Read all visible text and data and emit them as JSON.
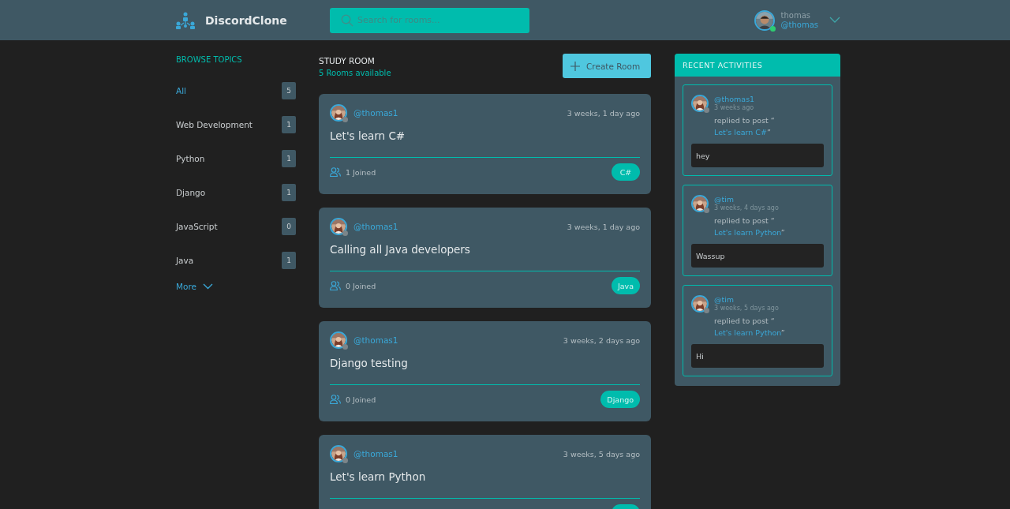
{
  "header": {
    "logo": "DiscordClone",
    "search": {
      "placeholder": "Search for rooms..."
    },
    "user": {
      "name": "thomas",
      "handle": "@thomas",
      "online": true
    }
  },
  "sidebar": {
    "title": "BROWSE TOPICS",
    "items": [
      {
        "label": "All",
        "count": "5",
        "selected": true
      },
      {
        "label": "Web Development",
        "count": "1",
        "selected": false
      },
      {
        "label": "Python",
        "count": "1",
        "selected": false
      },
      {
        "label": "Django",
        "count": "1",
        "selected": false
      },
      {
        "label": "JavaScript",
        "count": "0",
        "selected": false
      },
      {
        "label": "Java",
        "count": "1",
        "selected": false
      }
    ],
    "more": "More"
  },
  "main": {
    "title": "STUDY ROOM",
    "subtitle": "5 Rooms available",
    "create_button": "Create Room",
    "rooms": [
      {
        "host": "@thomas1",
        "online": false,
        "time": "3 weeks, 1 day ago",
        "name": "Let's learn C#",
        "joined": "1 Joined",
        "topic": "C#"
      },
      {
        "host": "@thomas1",
        "online": false,
        "time": "3 weeks, 1 day ago",
        "name": "Calling all Java developers",
        "joined": "0 Joined",
        "topic": "Java"
      },
      {
        "host": "@thomas1",
        "online": false,
        "time": "3 weeks, 2 days ago",
        "name": "Django testing",
        "joined": "0 Joined",
        "topic": "Django"
      },
      {
        "host": "@thomas1",
        "online": false,
        "time": "3 weeks, 5 days ago",
        "name": "Let's learn Python"
      }
    ]
  },
  "activities": {
    "title": "RECENT ACTIVITIES",
    "items": [
      {
        "user": "@thomas1",
        "online": false,
        "time": "3 weeks ago",
        "action": "replied to post “",
        "post": "Let's learn C#",
        "close": "”",
        "message": "hey"
      },
      {
        "user": "@tim",
        "online": false,
        "time": "3 weeks, 4 days ago",
        "action": "replied to post “",
        "post": "Let's learn Python",
        "close": "”",
        "message": "Wassup"
      },
      {
        "user": "@tim",
        "online": false,
        "time": "3 weeks, 5 days ago",
        "action": "replied to post “",
        "post": "Let's learn Python",
        "close": "”",
        "message": "Hi"
      }
    ]
  }
}
